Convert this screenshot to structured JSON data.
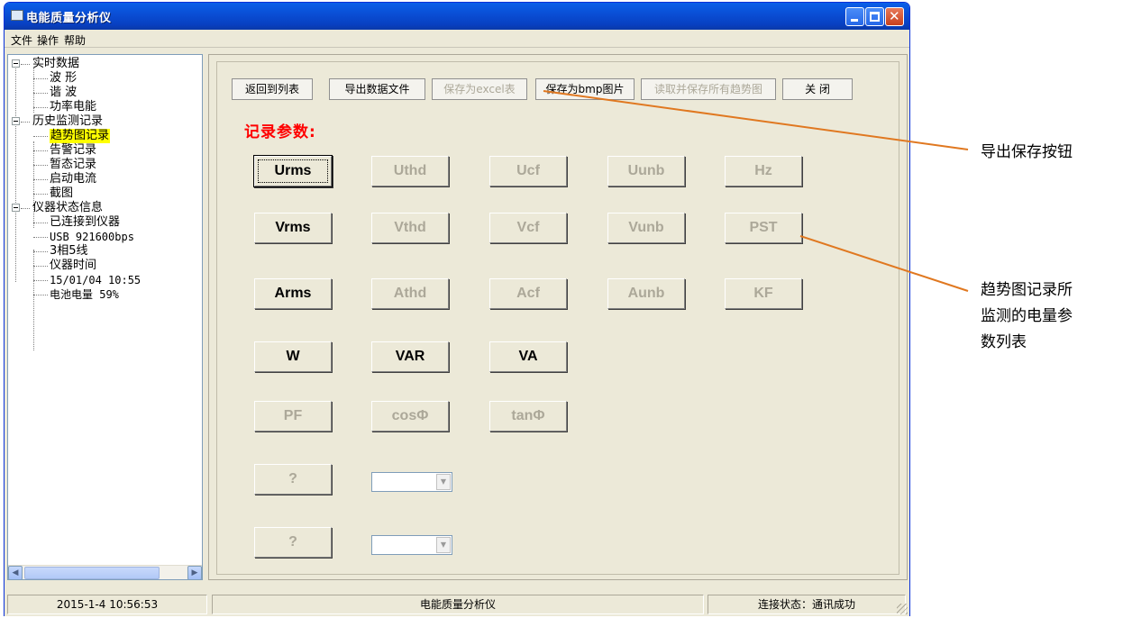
{
  "window": {
    "title": "电能质量分析仪"
  },
  "menu": [
    "文件",
    "操作",
    "帮助"
  ],
  "tree": {
    "realtime": {
      "label": "实时数据",
      "children": [
        "波 形",
        "谐 波",
        "功率电能"
      ]
    },
    "history": {
      "label": "历史监测记录",
      "children": [
        "趋势图记录",
        "告警记录",
        "暂态记录",
        "启动电流",
        "截图"
      ]
    },
    "status": {
      "label": "仪器状态信息",
      "children": [
        "已连接到仪器",
        "USB 921600bps",
        "3相5线",
        "仪器时间",
        "15/01/04 10:55",
        "电池电量 59%"
      ]
    }
  },
  "toolbar": {
    "back": "返回到列表",
    "export": "导出数据文件",
    "save_excel": "保存为excel表",
    "save_bmp": "保存为bmp图片",
    "read_save_all": "读取并保存所有趋势图",
    "close": "关 闭"
  },
  "params": {
    "heading": "记录参数:",
    "row1": [
      "Urms",
      "Uthd",
      "Ucf",
      "Uunb",
      "Hz"
    ],
    "row2": [
      "Vrms",
      "Vthd",
      "Vcf",
      "Vunb",
      "PST"
    ],
    "row3": [
      "Arms",
      "Athd",
      "Acf",
      "Aunb",
      "KF"
    ],
    "row4": [
      "W",
      "VAR",
      "VA"
    ],
    "row5": [
      "PF",
      "cosΦ",
      "tanΦ"
    ],
    "row6": [
      "?"
    ],
    "row7": [
      "?"
    ]
  },
  "statusbar": {
    "datetime": "2015-1-4 10:56:53",
    "app": "电能质量分析仪",
    "connection": "连接状态：通讯成功"
  },
  "annotations": {
    "export_buttons": "导出保存按钮",
    "param_list": [
      "趋势图记录所",
      "监测的电量参",
      "数列表"
    ]
  }
}
